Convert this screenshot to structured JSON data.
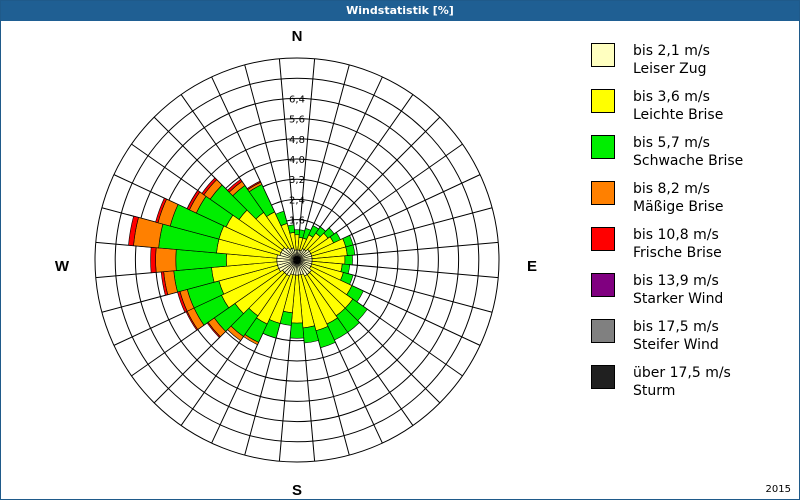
{
  "title": "Windstatistik [%]",
  "year": "2015",
  "directions": {
    "n": "N",
    "e": "E",
    "s": "S",
    "w": "W"
  },
  "legend": [
    {
      "range": "bis 2,1 m/s",
      "name": "Leiser Zug",
      "color": "#ffffc0"
    },
    {
      "range": "bis 3,6 m/s",
      "name": "Leichte Brise",
      "color": "#ffff00"
    },
    {
      "range": "bis 5,7 m/s",
      "name": "Schwache Brise",
      "color": "#00ee00"
    },
    {
      "range": "bis 8,2 m/s",
      "name": "Mäßige Brise",
      "color": "#ff8000"
    },
    {
      "range": "bis 10,8 m/s",
      "name": "Frische Brise",
      "color": "#ff0000"
    },
    {
      "range": "bis 13,9 m/s",
      "name": "Starker Wind",
      "color": "#800080"
    },
    {
      "range": "bis 17,5 m/s",
      "name": "Steifer Wind",
      "color": "#808080"
    },
    {
      "range": "über 17,5 m/s",
      "name": "Sturm",
      "color": "#202020"
    }
  ],
  "chart_data": {
    "type": "wind-rose",
    "title": "Windstatistik [%]",
    "unit": "%",
    "radial_ticks": [
      "1,6",
      "2,4",
      "3,2",
      "4,0",
      "4,8",
      "5,6",
      "6,4"
    ],
    "radial_tick_values": [
      1.6,
      2.4,
      3.2,
      4.0,
      4.8,
      5.6,
      6.4
    ],
    "rmax": 8.0,
    "sector_count": 36,
    "sector_width_deg": 10,
    "sector_directions_deg": [
      0,
      10,
      20,
      30,
      40,
      50,
      60,
      70,
      80,
      90,
      100,
      110,
      120,
      130,
      140,
      150,
      160,
      170,
      180,
      190,
      200,
      210,
      220,
      230,
      240,
      250,
      260,
      270,
      280,
      290,
      300,
      310,
      320,
      330,
      340,
      350
    ],
    "series": [
      {
        "name": "bis 2,1 m/s",
        "values": [
          0.4,
          0.4,
          0.4,
          0.5,
          0.5,
          0.6,
          0.6,
          0.6,
          0.6,
          0.6,
          0.6,
          0.6,
          0.6,
          0.7,
          0.7,
          0.7,
          0.6,
          0.6,
          0.6,
          0.6,
          0.6,
          0.7,
          0.7,
          0.7,
          0.8,
          0.8,
          0.8,
          0.8,
          0.8,
          0.7,
          0.7,
          0.7,
          0.6,
          0.5,
          0.5,
          0.4
        ]
      },
      {
        "name": "bis 3,6 m/s",
        "values": [
          0.6,
          0.5,
          0.5,
          0.6,
          0.8,
          0.9,
          1.0,
          1.4,
          1.4,
          1.3,
          1.2,
          1.3,
          1.8,
          2.0,
          2.0,
          2.1,
          2.3,
          2.1,
          1.9,
          1.5,
          2.0,
          2.1,
          2.0,
          2.3,
          2.5,
          2.4,
          2.6,
          2.0,
          2.4,
          2.5,
          2.4,
          2.1,
          1.7,
          1.6,
          1.0,
          0.7
        ]
      },
      {
        "name": "bis 5,7 m/s",
        "values": [
          0.2,
          0.3,
          0.4,
          0.4,
          0.3,
          0.3,
          0.3,
          0.3,
          0.3,
          0.3,
          0.3,
          0.4,
          0.5,
          0.7,
          0.8,
          0.7,
          0.7,
          0.6,
          0.6,
          0.5,
          0.6,
          0.8,
          1.0,
          1.0,
          1.2,
          1.3,
          1.5,
          2.0,
          2.3,
          2.0,
          1.3,
          1.4,
          1.3,
          1.2,
          0.5,
          0.3
        ]
      },
      {
        "name": "bis 8,2 m/s",
        "values": [
          0.0,
          0.0,
          0.0,
          0.0,
          0.0,
          0.0,
          0.0,
          0.0,
          0.0,
          0.0,
          0.0,
          0.0,
          0.0,
          0.0,
          0.0,
          0.0,
          0.0,
          0.0,
          0.0,
          0.0,
          0.0,
          0.1,
          0.2,
          0.3,
          0.3,
          0.3,
          0.4,
          0.8,
          1.0,
          0.5,
          0.3,
          0.3,
          0.2,
          0.1,
          0.0,
          0.0
        ]
      },
      {
        "name": "bis 10,8 m/s",
        "values": [
          0.0,
          0.0,
          0.0,
          0.0,
          0.0,
          0.0,
          0.0,
          0.0,
          0.0,
          0.0,
          0.0,
          0.0,
          0.0,
          0.0,
          0.0,
          0.0,
          0.0,
          0.0,
          0.0,
          0.0,
          0.0,
          0.0,
          0.0,
          0.05,
          0.05,
          0.1,
          0.1,
          0.2,
          0.2,
          0.1,
          0.1,
          0.1,
          0.1,
          0.05,
          0.0,
          0.0
        ]
      },
      {
        "name": "bis 13,9 m/s",
        "values": [
          0,
          0,
          0,
          0,
          0,
          0,
          0,
          0,
          0,
          0,
          0,
          0,
          0,
          0,
          0,
          0,
          0,
          0,
          0,
          0,
          0,
          0,
          0,
          0,
          0,
          0,
          0,
          0,
          0,
          0,
          0,
          0,
          0,
          0,
          0,
          0
        ]
      },
      {
        "name": "bis 17,5 m/s",
        "values": [
          0,
          0,
          0,
          0,
          0,
          0,
          0,
          0,
          0,
          0,
          0,
          0,
          0,
          0,
          0,
          0,
          0,
          0,
          0,
          0,
          0,
          0,
          0,
          0,
          0,
          0,
          0,
          0,
          0,
          0,
          0,
          0,
          0,
          0,
          0,
          0
        ]
      },
      {
        "name": "über 17,5 m/s",
        "values": [
          0,
          0,
          0,
          0,
          0,
          0,
          0,
          0,
          0,
          0,
          0,
          0,
          0,
          0,
          0,
          0,
          0,
          0,
          0,
          0,
          0,
          0,
          0,
          0,
          0,
          0,
          0,
          0,
          0,
          0,
          0,
          0,
          0,
          0,
          0,
          0
        ]
      }
    ]
  }
}
